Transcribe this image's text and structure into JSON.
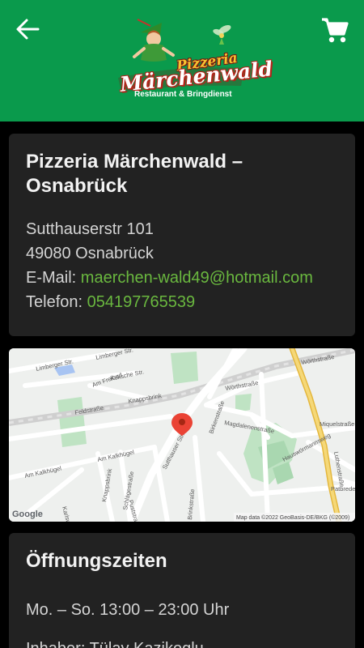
{
  "header": {
    "back_icon": "arrow-left-icon",
    "cart_icon": "shopping-cart-icon",
    "logo": {
      "line1": "Pizzeria",
      "line2": "Märchenwald",
      "line3": "Restaurant & Bringdienst"
    },
    "colors": {
      "background": "#0a9a4c",
      "accent": "#6ab83f"
    }
  },
  "info": {
    "title": "Pizzeria Märchenwald – Osnabrück",
    "street": "Sutthauserstr 101",
    "city": "49080 Osnabrück",
    "email_label": "E-Mail:",
    "email": "maerchen-wald49@hotmail.com",
    "phone_label": "Telefon:",
    "phone": "054197765539"
  },
  "map": {
    "streets": [
      "Limberger Str.",
      "Limberger Str.",
      "Am Freibad",
      "Koksche Str.",
      "Knappsbrink",
      "Feldstraße",
      "Am Kalkhügel",
      "Am Kalkhügel",
      "Knappsbrink",
      "Karlsweg",
      "Schlägestraße",
      "Puststraße",
      "Sutthauser Str.",
      "Brinkstraße",
      "Birkenstraße",
      "Wörthstraße",
      "Wörthstraße",
      "Magdalenenstraße",
      "Miquelstraße",
      "Hauswörmannsweg",
      "Luthenstraße",
      "Patbrede"
    ],
    "google_label": "Google",
    "attribution": "Map data ©2022 GeoBasis-DE/BKG (©2009)",
    "marker_icon": "map-pin-icon"
  },
  "hours": {
    "title": "Öffnungszeiten",
    "line": "Mo. – So. 13:00 – 23:00 Uhr",
    "owner": "Inhaber: Tülay Kazikoglu"
  }
}
